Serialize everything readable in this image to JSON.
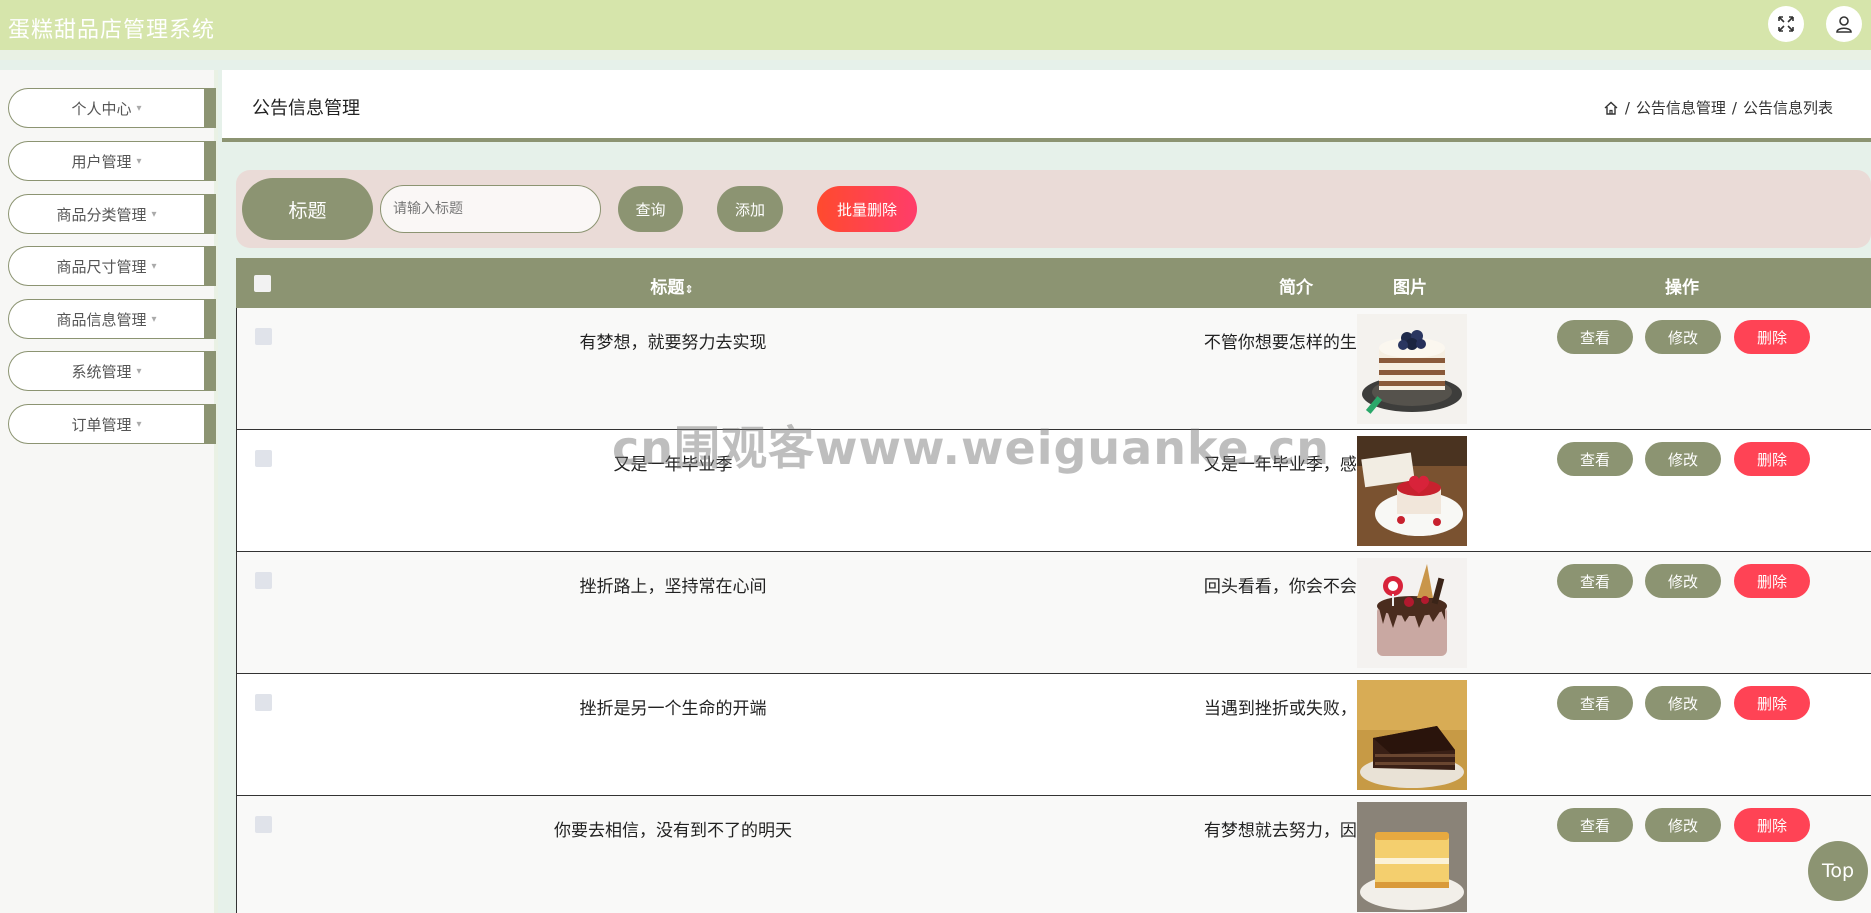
{
  "app": {
    "title": "蛋糕甜品店管理系统"
  },
  "header_icons": [
    "fullscreen-icon",
    "user-icon"
  ],
  "colors": {
    "accent": "#8c9472",
    "topbar": "#d6e5ab",
    "danger": "#ff4355",
    "search_panel": "#eadbd7"
  },
  "sidebar": {
    "items": [
      {
        "label": "个人中心"
      },
      {
        "label": "用户管理"
      },
      {
        "label": "商品分类管理"
      },
      {
        "label": "商品尺寸管理"
      },
      {
        "label": "商品信息管理"
      },
      {
        "label": "系统管理"
      },
      {
        "label": "订单管理"
      }
    ]
  },
  "page": {
    "title": "公告信息管理",
    "breadcrumb": {
      "separator": "/",
      "level1": "公告信息管理",
      "level2": "公告信息列表"
    }
  },
  "search": {
    "label": "标题",
    "placeholder": "请输入标题",
    "query_label": "查询",
    "add_label": "添加",
    "batch_delete_label": "批量删除"
  },
  "table": {
    "headers": {
      "title": "标题",
      "intro": "简介",
      "image": "图片",
      "actions": "操作"
    },
    "actions": {
      "view": "查看",
      "edit": "修改",
      "delete": "删除"
    },
    "rows": [
      {
        "title": "有梦想，就要努力去实现",
        "intro": "不管你想要怎样的生活...",
        "image": "blueberry-layer-cake"
      },
      {
        "title": "又是一年毕业季",
        "intro": "又是一年毕业季，感慨...",
        "image": "red-heart-cake"
      },
      {
        "title": "挫折路上，坚持常在心间",
        "intro": "回头看看，你会不会发...",
        "image": "chocolate-lollipop-cake"
      },
      {
        "title": "挫折是另一个生命的开端",
        "intro": "当遇到挫折或失败，你...",
        "image": "chocolate-cake-slice"
      },
      {
        "title": "你要去相信，没有到不了的明天",
        "intro": "有梦想就去努力，因为...",
        "image": "sponge-cake-slice"
      }
    ]
  },
  "watermark": "cn围观客www.weiguanke.cn",
  "back_to_top": "Top"
}
